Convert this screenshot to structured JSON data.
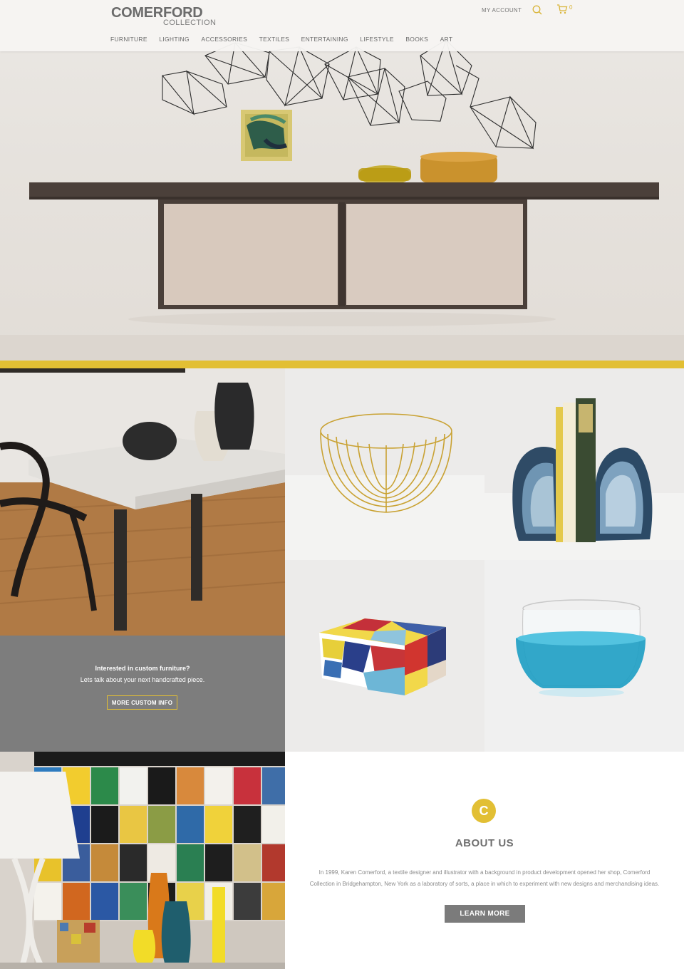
{
  "header": {
    "logo_main": "COMERFORD",
    "logo_sub": "COLLECTION",
    "nav": [
      "FURNITURE",
      "LIGHTING",
      "ACCESSORIES",
      "TEXTILES",
      "ENTERTAINING",
      "LIFESTYLE",
      "BOOKS",
      "ART"
    ],
    "account_label": "MY ACCOUNT",
    "cart_count": "0"
  },
  "colors": {
    "accent": "#e2bf34",
    "gray_panel": "#7d7d7d",
    "button_gray": "#7b7b7b"
  },
  "hero": {
    "image": "floating-console-shelf-with-wire-wall-sculpture"
  },
  "grid": {
    "tiles": [
      "dining-table-with-ceramic-vases",
      "gold-wire-basket",
      "agate-bookends-with-books",
      "painted-geometric-box",
      "blue-glass-bowl"
    ]
  },
  "custom": {
    "title": "Interested in custom furniture?",
    "text": "Lets talk about your next handcrafted piece.",
    "button": "MORE CUSTOM INFO"
  },
  "art_tile": {
    "image": "abstract-art-tile-wall-with-lamp-and-vases"
  },
  "about": {
    "icon_letter": "C",
    "title": "ABOUT US",
    "text": "In 1999, Karen Comerford, a textile designer and illustrator with a background in product development opened her shop, Comerford Collection in Bridgehampton, New York as a laboratory of sorts, a place in which to experiment with new designs and merchandising ideas.",
    "button": "LEARN MORE"
  }
}
